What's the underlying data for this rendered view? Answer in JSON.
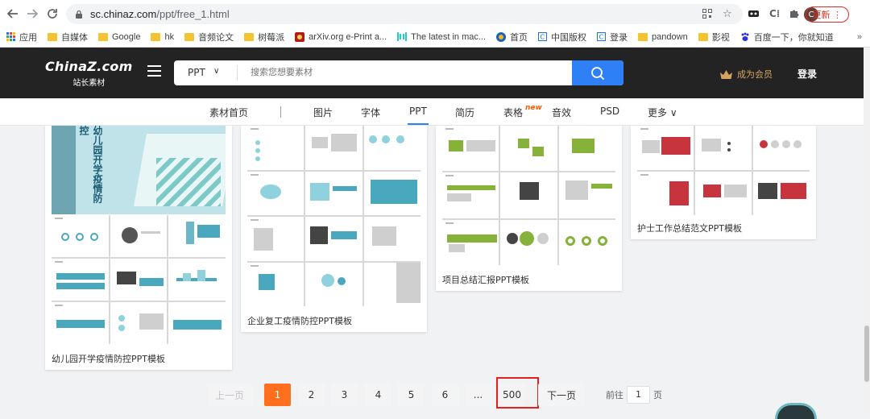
{
  "browser": {
    "url_host": "sc.chinaz.com",
    "url_path": "/ppt/free_1.html",
    "update_label": "更新",
    "avatar_letter": "C"
  },
  "bookmarks": [
    {
      "label": "应用",
      "icon": "apps-grid-icon"
    },
    {
      "label": "自媒体",
      "icon": "folder-icon"
    },
    {
      "label": "Google",
      "icon": "folder-icon"
    },
    {
      "label": "hk",
      "icon": "folder-icon"
    },
    {
      "label": "音频论文",
      "icon": "folder-icon"
    },
    {
      "label": "树莓派",
      "icon": "folder-icon"
    },
    {
      "label": "arXiv.org e-Print a...",
      "icon": "arxiv-icon"
    },
    {
      "label": "The latest in mac...",
      "icon": "paperswithcode-icon"
    },
    {
      "label": "首页",
      "icon": "globe-icon"
    },
    {
      "label": "中国版权",
      "icon": "c-icon"
    },
    {
      "label": "登录",
      "icon": "c-icon"
    },
    {
      "label": "pandown",
      "icon": "folder-icon"
    },
    {
      "label": "影视",
      "icon": "folder-icon"
    },
    {
      "label": "百度一下，你就知道",
      "icon": "baidu-paw-icon"
    }
  ],
  "site": {
    "logo_main": "ChinaZ.com",
    "logo_sub": "站长素材",
    "search_category": "PPT",
    "search_placeholder": "搜索您想要素材",
    "vip_label": "成为会员",
    "login_label": "登录"
  },
  "category_nav": {
    "items": [
      "素材首页",
      "图片",
      "字体",
      "PPT",
      "简历",
      "表格",
      "音效",
      "PSD",
      "更多"
    ],
    "active": "PPT",
    "new_tag": "new"
  },
  "cards": [
    {
      "title": "幼儿园开学疫情防控PPT模板",
      "cover_text": "幼儿园开学疫情防控"
    },
    {
      "title": "企业复工疫情防控PPT模板"
    },
    {
      "title": "项目总结汇报PPT模板"
    },
    {
      "title": "护士工作总结范文PPT模板"
    }
  ],
  "pagination": {
    "prev": "上一页",
    "pages": [
      "1",
      "2",
      "3",
      "4",
      "5",
      "6",
      "...",
      "500"
    ],
    "current": "1",
    "next": "下一页",
    "goto_prefix": "前往",
    "goto_value": "1",
    "goto_suffix": "页"
  },
  "colors": {
    "accent_blue": "#2f7ff7",
    "page_current": "#ff6f1e",
    "highlight_box": "#e32020",
    "header_dark": "#232323",
    "vip_gold": "#d4a45f"
  }
}
